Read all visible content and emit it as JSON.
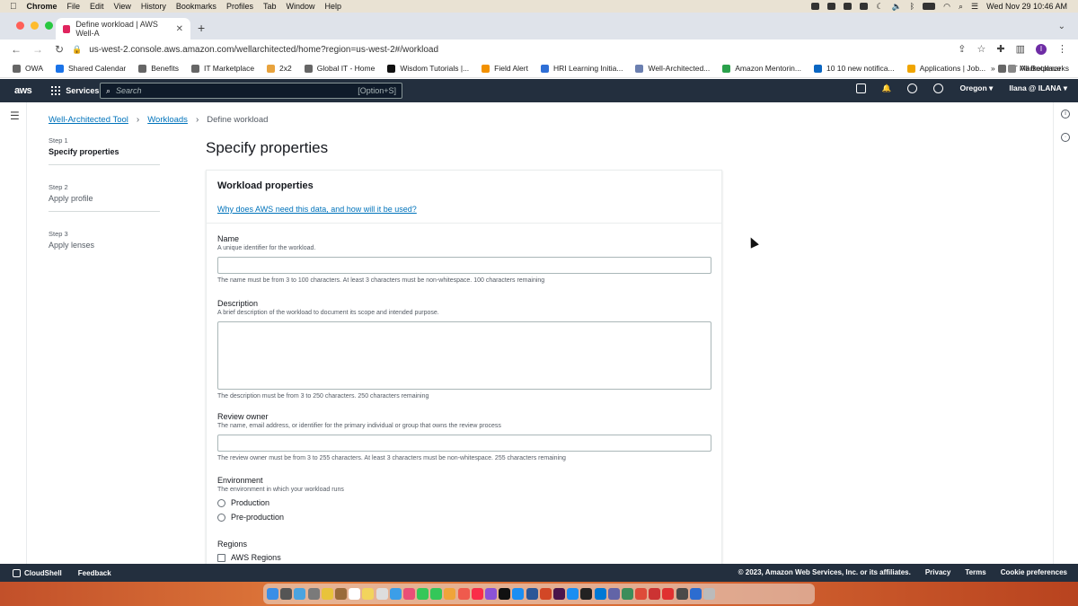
{
  "mac_menu": {
    "app": "Chrome",
    "items": [
      "File",
      "Edit",
      "View",
      "History",
      "Bookmarks",
      "Profiles",
      "Tab",
      "Window",
      "Help"
    ],
    "clock": "Wed Nov 29  10:46 AM"
  },
  "browser": {
    "tab_title": "Define workload | AWS Well-A",
    "url": "us-west-2.console.aws.amazon.com/wellarchitected/home?region=us-west-2#/workload",
    "profile_initial": "I",
    "bookmarks": [
      "OWA",
      "Shared Calendar",
      "Benefits",
      "IT Marketplace",
      "2x2",
      "Global IT - Home",
      "Wisdom Tutorials |...",
      "Field Alert",
      "HRI Learning Initia...",
      "Well-Architected...",
      "Amazon Mentorin...",
      "10 10 new notifica...",
      "Applications | Job...",
      "IT Marketplace"
    ],
    "all_bookmarks": "All Bookmarks",
    "overflow": "»"
  },
  "aws_nav": {
    "logo": "aws",
    "services": "Services",
    "search_placeholder": "Search",
    "search_shortcut": "[Option+S]",
    "region": "Oregon ▾",
    "account": "Ilana @ ILANA ▾"
  },
  "breadcrumb": {
    "items": [
      "Well-Architected Tool",
      "Workloads"
    ],
    "current": "Define workload"
  },
  "steps": [
    {
      "label": "Step 1",
      "name": "Specify properties"
    },
    {
      "label": "Step 2",
      "name": "Apply profile"
    },
    {
      "label": "Step 3",
      "name": "Apply lenses"
    }
  ],
  "page_title": "Specify properties",
  "card": {
    "title": "Workload properties",
    "info_link": "Why does AWS need this data, and how will it be used?"
  },
  "fields": {
    "name": {
      "label": "Name",
      "desc": "A unique identifier for the workload.",
      "constraint": "The name must be from 3 to 100 characters. At least 3 characters must be non-whitespace. 100 characters remaining"
    },
    "description": {
      "label": "Description",
      "desc": "A brief description of the workload to document its scope and intended purpose.",
      "constraint": "The description must be from 3 to 250 characters. 250 characters remaining"
    },
    "review_owner": {
      "label": "Review owner",
      "desc": "The name, email address, or identifier for the primary individual or group that owns the review process",
      "constraint": "The review owner must be from 3 to 255 characters. At least 3 characters must be non-whitespace. 255 characters remaining"
    },
    "environment": {
      "label": "Environment",
      "desc": "The environment in which your workload runs",
      "options": [
        "Production",
        "Pre-production"
      ]
    },
    "regions": {
      "label": "Regions",
      "option": "AWS Regions"
    }
  },
  "footer": {
    "cloudshell": "CloudShell",
    "feedback": "Feedback",
    "copyright": "© 2023, Amazon Web Services, Inc. or its affiliates.",
    "links": [
      "Privacy",
      "Terms",
      "Cookie preferences"
    ]
  }
}
